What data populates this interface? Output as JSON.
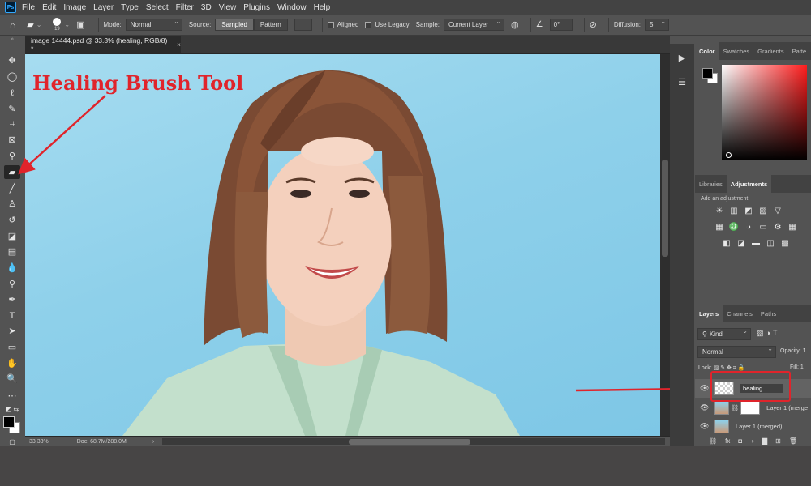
{
  "menu": {
    "logo": "Ps",
    "items": [
      "File",
      "Edit",
      "Image",
      "Layer",
      "Type",
      "Select",
      "Filter",
      "3D",
      "View",
      "Plugins",
      "Window",
      "Help"
    ]
  },
  "options": {
    "brush_size": "19",
    "mode_label": "Mode:",
    "mode_value": "Normal",
    "source_label": "Source:",
    "source_sampled": "Sampled",
    "source_pattern": "Pattern",
    "aligned": "Aligned",
    "use_legacy": "Use Legacy",
    "sample_label": "Sample:",
    "sample_value": "Current Layer",
    "angle": "0°",
    "diffusion_label": "Diffusion:",
    "diffusion_value": "5"
  },
  "document": {
    "tab_title": "image 14444.psd @ 33.3% (healing, RGB/8) *",
    "close": "×",
    "zoom": "33.33%",
    "doc_info": "Doc: 68.7M/288.0M",
    "status_arrow": "›"
  },
  "annotation": {
    "title": "Healing Brush Tool",
    "color": "#e0242b"
  },
  "panels": {
    "color_tabs": [
      "Color",
      "Swatches",
      "Gradients",
      "Patte"
    ],
    "adjust_tabs": [
      "Libraries",
      "Adjustments"
    ],
    "add_adjustment": "Add an adjustment",
    "adjust_icons": [
      [
        "☀",
        "▥",
        "◩",
        "▨",
        "▽"
      ],
      [
        "▦",
        "♎",
        "◑",
        "▭",
        "⚙",
        "▦"
      ],
      [
        "◧",
        "◪",
        "▬",
        "◫",
        "▩"
      ]
    ],
    "layer_tabs": [
      "Layers",
      "Channels",
      "Paths"
    ],
    "kind": "Kind",
    "blend": "Normal",
    "opacity_label": "Opacity:",
    "opacity_value": "1",
    "lock_label": "Lock:",
    "fill_label": "Fill:",
    "fill_value": "1",
    "layers": [
      {
        "name": "healing"
      },
      {
        "name": "Layer 1 (merge"
      },
      {
        "name": "Layer 1 (merged)"
      }
    ],
    "footer_icons": [
      "⛓",
      "fx",
      "◘",
      "◑",
      "▇",
      "⊞",
      "🗑"
    ]
  }
}
